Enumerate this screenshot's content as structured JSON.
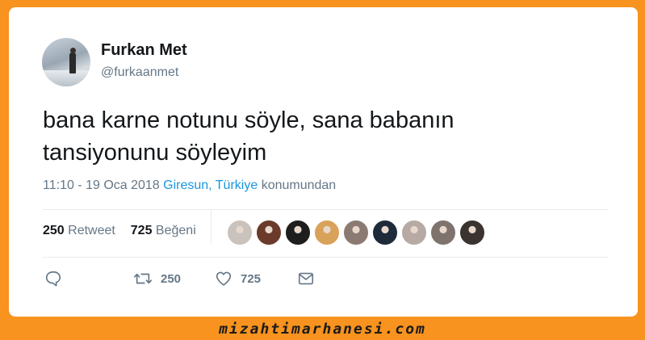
{
  "user": {
    "name": "Furkan Met",
    "handle": "@furkaanmet"
  },
  "tweet": {
    "text_line1": "bana karne notunu söyle, sana babanın",
    "text_line2": "tansiyonunu söyleyim"
  },
  "meta": {
    "datetime": "11:10 - 19 Oca 2018",
    "location_link": "Giresun, Türkiye",
    "location_suffix": "konumundan"
  },
  "stats": {
    "retweet_count": "250",
    "retweet_label": "Retweet",
    "like_count": "725",
    "like_label": "Beğeni"
  },
  "likers": [
    {
      "icon": "liker-avatar",
      "color": "#c9c2bd"
    },
    {
      "icon": "liker-avatar",
      "color": "#6b3a2a"
    },
    {
      "icon": "liker-avatar",
      "color": "#1e1e1e"
    },
    {
      "icon": "liker-avatar",
      "color": "#d9a25a"
    },
    {
      "icon": "liker-avatar",
      "color": "#8a7a72"
    },
    {
      "icon": "liker-avatar",
      "color": "#1f2a3a"
    },
    {
      "icon": "liker-avatar",
      "color": "#b7aaa4"
    },
    {
      "icon": "liker-avatar",
      "color": "#7f736e"
    },
    {
      "icon": "liker-avatar",
      "color": "#3b3330"
    }
  ],
  "actions": {
    "reply_icon": "reply-icon",
    "retweet_icon": "retweet-icon",
    "retweet_count": "250",
    "like_icon": "heart-icon",
    "like_count": "725",
    "dm_icon": "envelope-icon"
  },
  "watermark": "mizahtimarhanesi.com",
  "colors": {
    "background": "#f7931e",
    "link": "#1b95e0",
    "muted": "#657786",
    "text": "#14171a"
  }
}
